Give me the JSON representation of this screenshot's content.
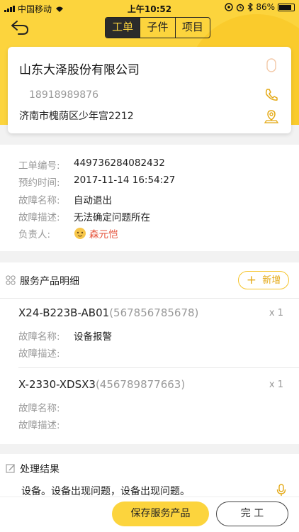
{
  "status_bar": {
    "carrier": "中国移动",
    "time": "上午10:52",
    "battery": "86%"
  },
  "nav": {
    "tabs": [
      "工单",
      "子件",
      "项目"
    ],
    "active_tab": "工单"
  },
  "customer": {
    "company": "山东大泽股份有限公司",
    "phone": "18918989876",
    "address": "济南市槐荫区少年宫2212"
  },
  "details": {
    "rows": [
      {
        "label": "工单编号:",
        "value": "449736284082432"
      },
      {
        "label": "预约时间:",
        "value": "2017-11-14 16:54:27"
      },
      {
        "label": "故障名称:",
        "value": "自动退出"
      },
      {
        "label": "故障描述:",
        "value": "无法确定问题所在"
      }
    ],
    "owner_label": "负责人:",
    "owner": "森元恺"
  },
  "services": {
    "title": "服务产品明细",
    "add_label": "新增",
    "items": [
      {
        "model": "X24-B223B-AB01",
        "serial": "(567856785678)",
        "qty": "x 1",
        "fault_name_label": "故障名称:",
        "fault_name": "设备报警",
        "fault_desc_label": "故障描述:",
        "fault_desc": ""
      },
      {
        "model": "X-2330-XDSX3",
        "serial": "(456789877663)",
        "qty": "x 1",
        "fault_name_label": "故障名称:",
        "fault_name": "",
        "fault_desc_label": "故障描述:",
        "fault_desc": ""
      }
    ]
  },
  "result": {
    "title": "处理结果",
    "text": "设备。设备出现问题，设备出现问题。"
  },
  "actions": {
    "save_label": "保存服务产品",
    "done_label": "完 工"
  },
  "colors": {
    "accent": "#fcd43d",
    "owner": "#e5523a",
    "icon": "#e4a915"
  }
}
